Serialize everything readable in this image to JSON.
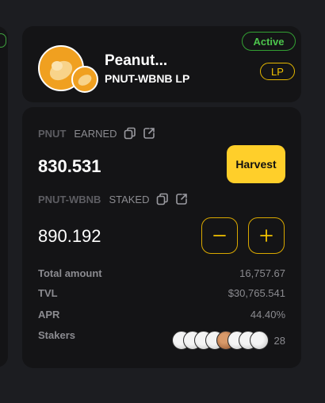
{
  "pool": {
    "title": "Peanut...",
    "pair": "PNUT-WBNB LP",
    "status_badge": "Active",
    "type_badge": "LP"
  },
  "earned": {
    "token": "PNUT",
    "label": "EARNED",
    "value": "830.531",
    "harvest_label": "Harvest"
  },
  "staked": {
    "token": "PNUT-WBNB",
    "label": "STAKED",
    "value": "890.192"
  },
  "stats": {
    "total_amount_label": "Total amount",
    "total_amount_value": "16,757.67",
    "tvl_label": "TVL",
    "tvl_value": "$30,765.541",
    "apr_label": "APR",
    "apr_value": "44.40%",
    "stakers_label": "Stakers",
    "stakers_count": "28"
  },
  "colors": {
    "accent": "#ffcf2a",
    "active": "#33a033",
    "card": "#141416",
    "background": "#1c1d21"
  },
  "icons": [
    "copy-icon",
    "external-link-icon",
    "minus-icon",
    "plus-icon",
    "peanut-token-icon"
  ]
}
